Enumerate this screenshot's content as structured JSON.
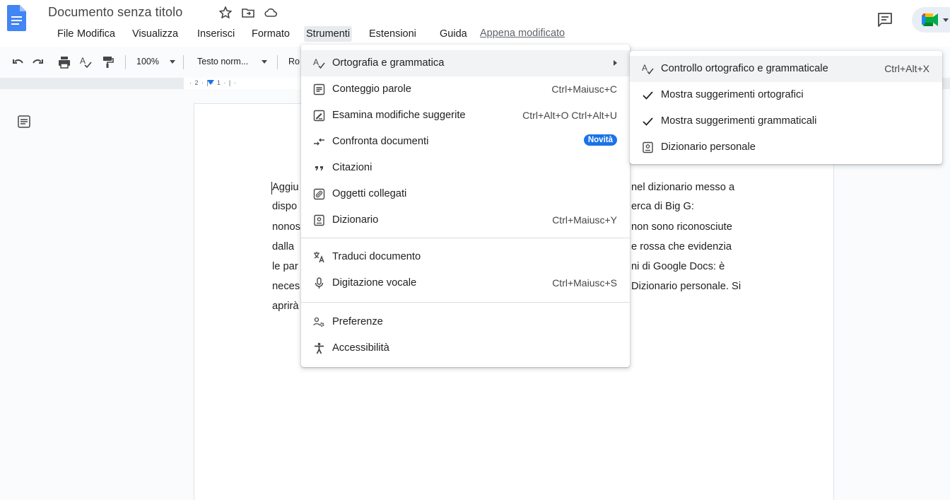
{
  "header": {
    "doc_title": "Documento senza titolo",
    "last_edit": "Appena modificato",
    "menus": [
      "File",
      "Modifica",
      "Visualizza",
      "Inserisci",
      "Formato",
      "Strumenti",
      "Estensioni",
      "Guida"
    ],
    "active_menu": "Strumenti"
  },
  "toolbar": {
    "zoom": "100%",
    "style": "Testo norm...",
    "font_partial": "Ro"
  },
  "ruler": {
    "marks": "· 2 · | · 1 · | ·"
  },
  "document": {
    "left_lines": [
      "Aggiu",
      "dispo",
      "nonos",
      "dalla",
      "le par",
      "neces",
      "aprirà"
    ],
    "right_lines": [
      "nel dizionario messo a",
      "erca di Big G:",
      "non sono riconosciute",
      "e rossa che evidenzia",
      "ni di Google Docs: è",
      "Dizionario personale. Si"
    ]
  },
  "tools_menu": {
    "items": [
      {
        "label": "Ortografia e grammatica",
        "icon": "spellcheck-icon",
        "submenu": true
      },
      {
        "label": "Conteggio parole",
        "icon": "word-count-icon",
        "shortcut": "Ctrl+Maiusc+C"
      },
      {
        "label": "Esamina modifiche suggerite",
        "icon": "review-edits-icon",
        "shortcut": "Ctrl+Alt+O Ctrl+Alt+U"
      },
      {
        "label": "Confronta documenti",
        "icon": "compare-icon",
        "badge": "Novità"
      },
      {
        "label": "Citazioni",
        "icon": "quote-icon"
      },
      {
        "label": "Oggetti collegati",
        "icon": "linked-objects-icon"
      },
      {
        "label": "Dizionario",
        "icon": "dictionary-icon",
        "shortcut": "Ctrl+Maiusc+Y"
      },
      {
        "label": "Traduci documento",
        "icon": "translate-icon"
      },
      {
        "label": "Digitazione vocale",
        "icon": "microphone-icon",
        "shortcut": "Ctrl+Maiusc+S"
      },
      {
        "label": "Preferenze",
        "icon": "preferences-icon"
      },
      {
        "label": "Accessibilità",
        "icon": "accessibility-icon"
      }
    ]
  },
  "spelling_submenu": {
    "items": [
      {
        "label": "Controllo ortografico e grammaticale",
        "icon": "spellcheck-icon",
        "shortcut": "Ctrl+Alt+X"
      },
      {
        "label": "Mostra suggerimenti ortografici",
        "icon": "check-icon",
        "checked": true
      },
      {
        "label": "Mostra suggerimenti grammaticali",
        "icon": "check-icon",
        "checked": true
      },
      {
        "label": "Dizionario personale",
        "icon": "dictionary-icon"
      }
    ]
  },
  "colors": {
    "docs_blue": "#4285f4",
    "accent_blue": "#1a73e8",
    "menu_highlight": "#f1f3f4"
  }
}
